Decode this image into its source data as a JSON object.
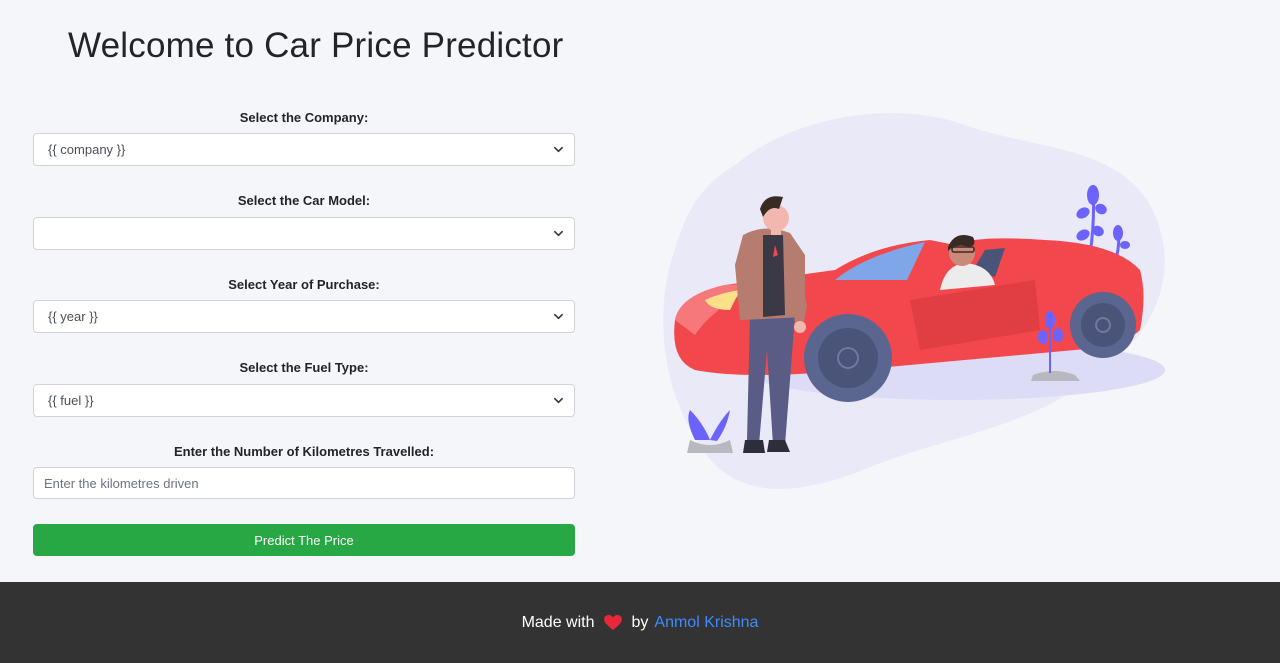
{
  "header": {
    "title": "Welcome to Car Price Predictor"
  },
  "form": {
    "company_label": "Select the Company:",
    "company_value": "{{ company }}",
    "model_label": "Select the Car Model:",
    "model_value": "",
    "year_label": "Select Year of Purchase:",
    "year_value": "{{ year }}",
    "fuel_label": "Select the Fuel Type:",
    "fuel_value": "{{ fuel }}",
    "kms_label": "Enter the Number of Kilometres Travelled:",
    "kms_placeholder": "Enter the kilometres driven",
    "submit_label": "Predict The Price"
  },
  "footer": {
    "made_with": "Made with",
    "by": "by",
    "author": "Anmol Krishna"
  },
  "colors": {
    "accent_green": "#28a745",
    "footer_bg": "#333333",
    "link_blue": "#3d8bfd",
    "car_red": "#f2474c"
  },
  "icons": {
    "select_caret": "chevron-down-icon",
    "heart": "heart-icon"
  }
}
